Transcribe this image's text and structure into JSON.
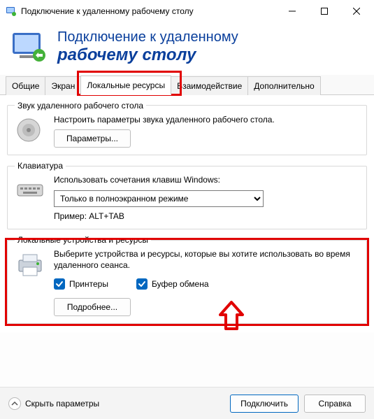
{
  "titlebar": {
    "title": "Подключение к удаленному рабочему столу"
  },
  "header": {
    "line1": "Подключение к удаленному",
    "line2": "рабочему столу"
  },
  "tabs": {
    "general": "Общие",
    "screen": "Экран",
    "local": "Локальные ресурсы",
    "experience": "Взаимодействие",
    "advanced": "Дополнительно"
  },
  "audio": {
    "legend": "Звук удаленного рабочего стола",
    "desc": "Настроить параметры звука удаленного рабочего стола.",
    "settings_btn": "Параметры..."
  },
  "keyboard": {
    "legend": "Клавиатура",
    "desc": "Использовать сочетания клавиш Windows:",
    "selected": "Только в полноэкранном режиме",
    "example": "Пример: ALT+TAB"
  },
  "devices": {
    "legend": "Локальные устройства и ресурсы",
    "desc": "Выберите устройства и ресурсы, которые вы хотите использовать во время удаленного сеанса.",
    "printers": "Принтеры",
    "clipboard": "Буфер обмена",
    "more_btn": "Подробнее..."
  },
  "footer": {
    "hide": "Скрыть параметры",
    "connect": "Подключить",
    "help": "Справка"
  }
}
